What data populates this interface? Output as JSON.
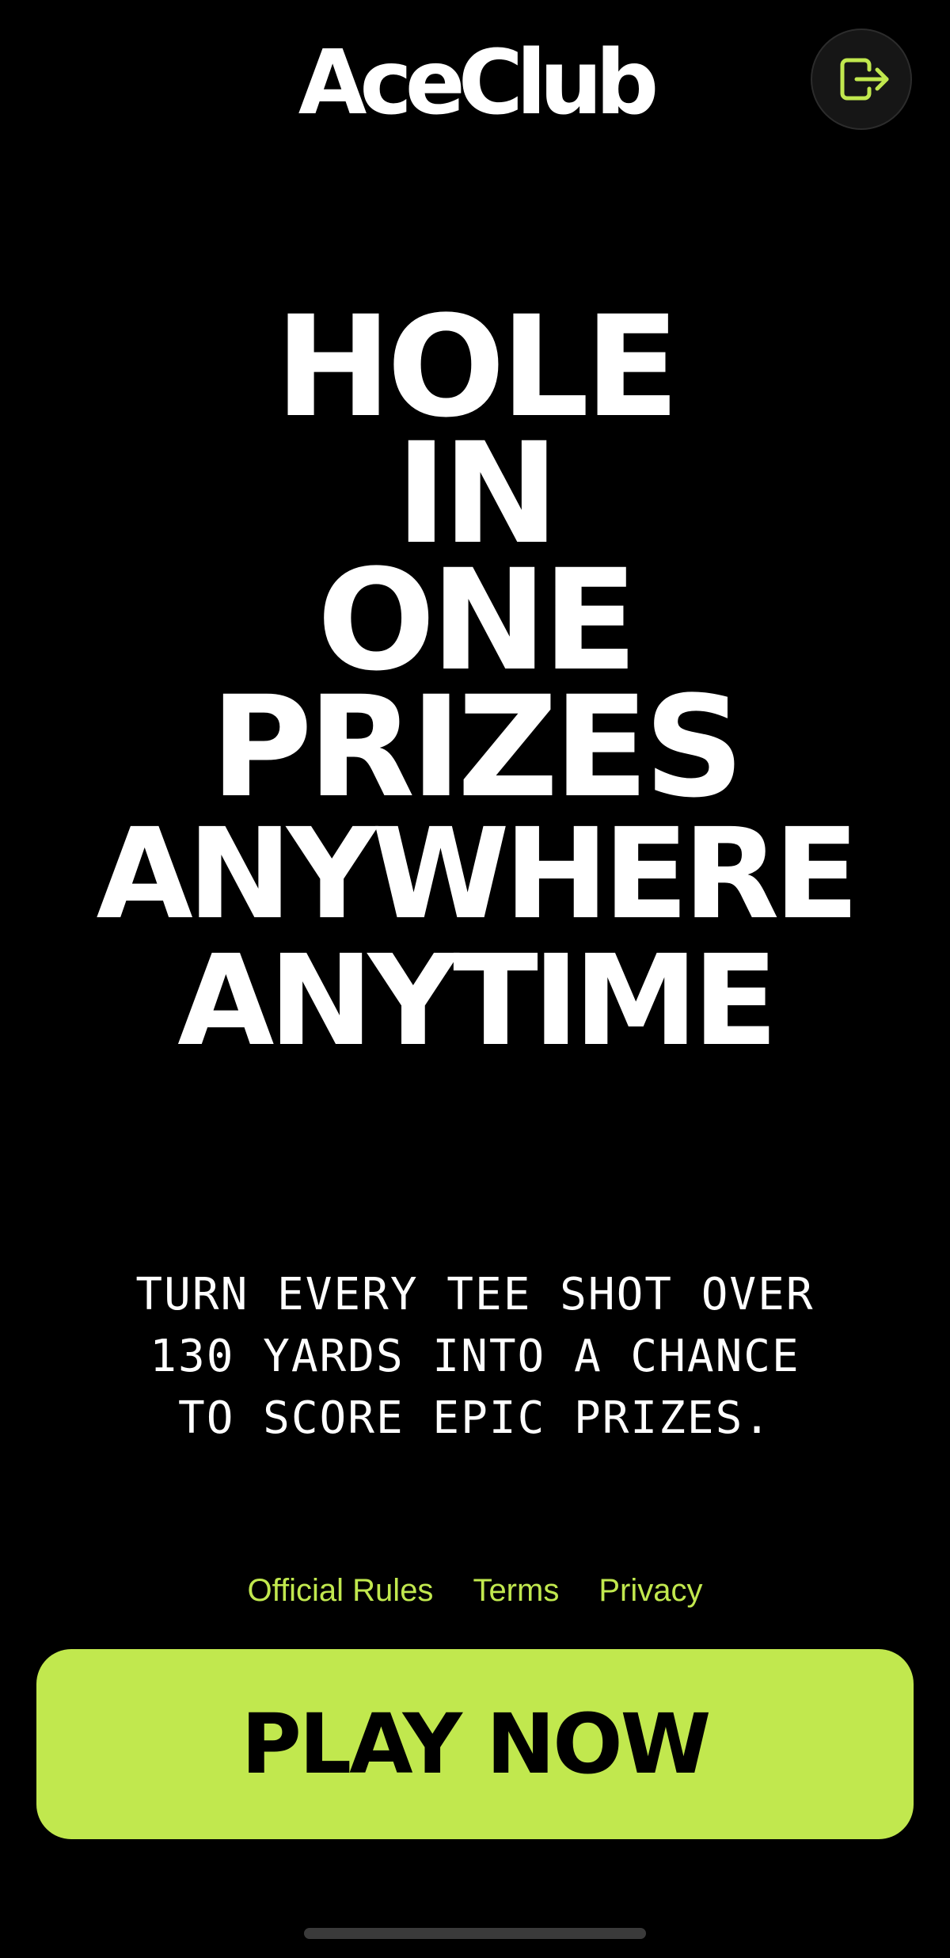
{
  "header": {
    "logo_text": "AceClub",
    "exit_icon": "exit-arrow-icon"
  },
  "headline": {
    "lines": [
      "HOLE",
      "IN",
      "ONE",
      "PRIZES",
      "ANYWHERE",
      "ANYTIME"
    ]
  },
  "subtitle": {
    "lines": [
      "TURN EVERY TEE SHOT OVER",
      "130 YARDS INTO A CHANCE",
      "TO SCORE EPIC PRIZES."
    ]
  },
  "links": {
    "official_rules": "Official Rules",
    "terms": "Terms",
    "privacy": "Privacy"
  },
  "cta": {
    "play_label": "PLAY NOW"
  },
  "colors": {
    "accent": "#c1e84e",
    "background": "#000000",
    "text": "#ffffff"
  }
}
